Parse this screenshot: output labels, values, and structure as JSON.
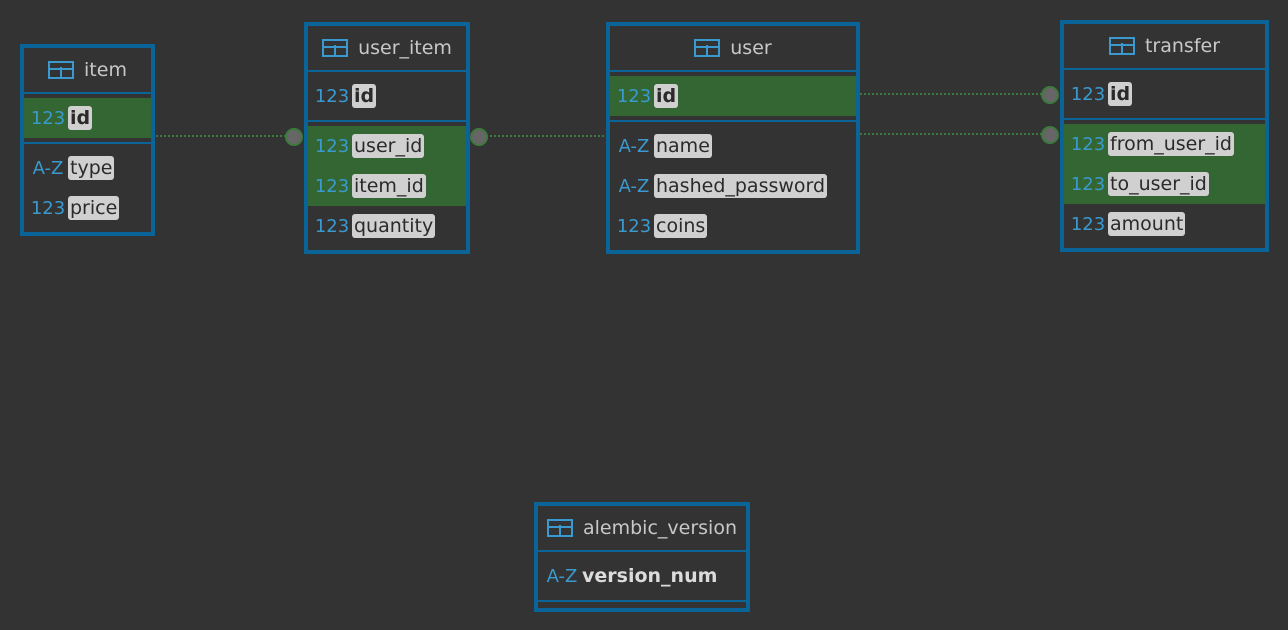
{
  "tables": {
    "item": {
      "title": "item",
      "sections": [
        [
          {
            "type": "123",
            "name": "id",
            "pk": true,
            "hl": true
          }
        ],
        [
          {
            "type": "A-Z",
            "name": "type"
          },
          {
            "type": "123",
            "name": "price"
          }
        ]
      ]
    },
    "user_item": {
      "title": "user_item",
      "sections": [
        [
          {
            "type": "123",
            "name": "id",
            "pk": true
          }
        ],
        [
          {
            "type": "123",
            "name": "user_id",
            "hl": true
          },
          {
            "type": "123",
            "name": "item_id",
            "hl": true
          },
          {
            "type": "123",
            "name": "quantity"
          }
        ]
      ]
    },
    "user": {
      "title": "user",
      "sections": [
        [
          {
            "type": "123",
            "name": "id",
            "pk": true,
            "hl": true
          }
        ],
        [
          {
            "type": "A-Z",
            "name": "name"
          },
          {
            "type": "A-Z",
            "name": "hashed_password"
          },
          {
            "type": "123",
            "name": "coins"
          }
        ]
      ]
    },
    "transfer": {
      "title": "transfer",
      "sections": [
        [
          {
            "type": "123",
            "name": "id",
            "pk": true
          }
        ],
        [
          {
            "type": "123",
            "name": "from_user_id",
            "hl": true
          },
          {
            "type": "123",
            "name": "to_user_id",
            "hl": true
          },
          {
            "type": "123",
            "name": "amount"
          }
        ]
      ]
    },
    "alembic_version": {
      "title": "alembic_version",
      "sections": [
        [
          {
            "type": "A-Z",
            "name": "version_num",
            "plain": true
          }
        ],
        []
      ]
    }
  },
  "colors": {
    "border": "#0a6497",
    "highlight": "#336633",
    "link": "#3d7a3d"
  }
}
